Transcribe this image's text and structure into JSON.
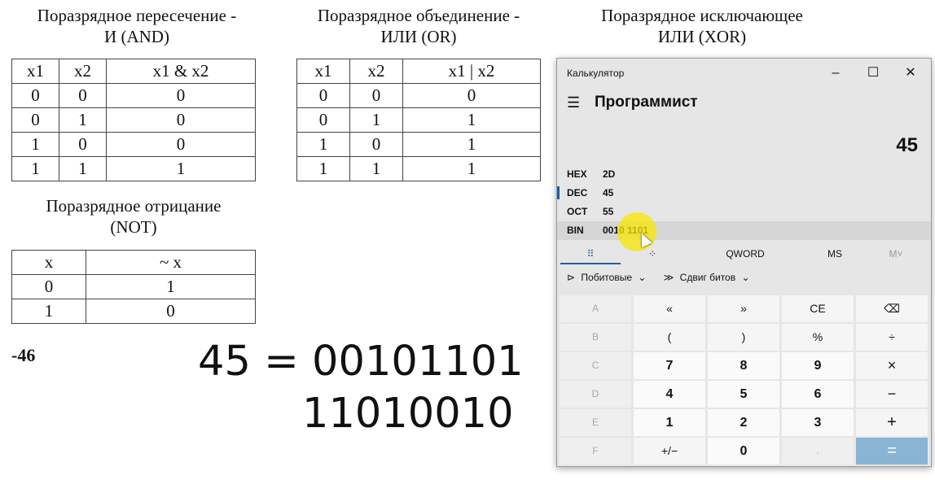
{
  "headings": {
    "and": [
      "Поразрядное пересечение -",
      "И (AND)"
    ],
    "or": [
      "Поразрядное объединение -",
      "ИЛИ (OR)"
    ],
    "xor": [
      "Поразрядное исключающее",
      "ИЛИ (XOR)"
    ],
    "not": [
      "Поразрядное отрицание",
      "(NOT)"
    ]
  },
  "and_table": {
    "headers": [
      "x1",
      "x2",
      "x1 & x2"
    ],
    "rows": [
      [
        "0",
        "0",
        "0"
      ],
      [
        "0",
        "1",
        "0"
      ],
      [
        "1",
        "0",
        "0"
      ],
      [
        "1",
        "1",
        "1"
      ]
    ]
  },
  "or_table": {
    "headers": [
      "x1",
      "x2",
      "x1 | x2"
    ],
    "rows": [
      [
        "0",
        "0",
        "0"
      ],
      [
        "0",
        "1",
        "1"
      ],
      [
        "1",
        "0",
        "1"
      ],
      [
        "1",
        "1",
        "1"
      ]
    ]
  },
  "not_table": {
    "headers": [
      "x",
      "~ x"
    ],
    "rows": [
      [
        "0",
        "1"
      ],
      [
        "1",
        "0"
      ]
    ]
  },
  "negative_value": "-46",
  "big_text": {
    "line1": "45 = 00101101",
    "line2": "11010010"
  },
  "calculator": {
    "title": "Калькулятор",
    "window_buttons": {
      "minimize": "–",
      "maximize": "☐",
      "close": "✕"
    },
    "mode": "Программист",
    "display": "45",
    "radix": [
      {
        "label": "HEX",
        "value": "2D"
      },
      {
        "label": "DEC",
        "value": "45"
      },
      {
        "label": "OCT",
        "value": "55"
      },
      {
        "label": "BIN",
        "value": "0010 1101"
      }
    ],
    "tabs": {
      "keypad_icon": "⠿",
      "bit_icon": "⁘",
      "qword": "QWORD",
      "ms": "MS",
      "mplus": "M˅"
    },
    "bitwise": {
      "label": "Побитовые",
      "shift": "Сдвиг битов"
    },
    "keys": [
      [
        "A",
        "«",
        "»",
        "CE",
        "⌫"
      ],
      [
        "B",
        "(",
        ")",
        "%",
        "÷"
      ],
      [
        "C",
        "7",
        "8",
        "9",
        "×"
      ],
      [
        "D",
        "4",
        "5",
        "6",
        "−"
      ],
      [
        "E",
        "1",
        "2",
        "3",
        "+"
      ],
      [
        "F",
        "+/−",
        "0",
        ".",
        "="
      ]
    ]
  }
}
